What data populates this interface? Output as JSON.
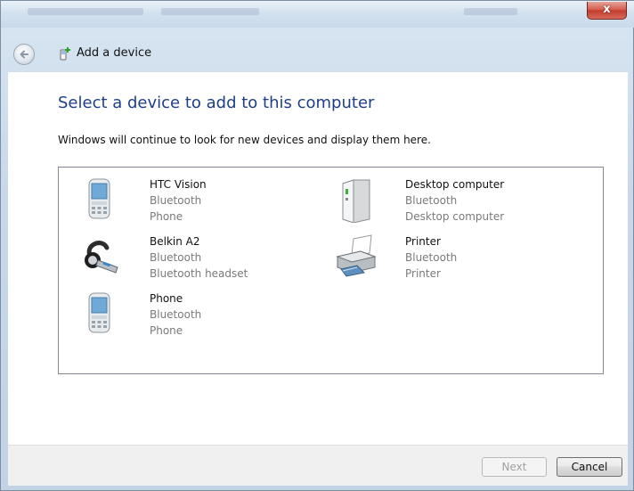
{
  "window": {
    "close_glyph": "x"
  },
  "nav": {
    "title": "Add a device"
  },
  "main": {
    "heading": "Select a device to add to this computer",
    "subtext": "Windows will continue to look for new devices and display them here."
  },
  "devices": [
    {
      "name": "HTC Vision",
      "connection": "Bluetooth",
      "category": "Phone",
      "icon": "mobile-phone-icon"
    },
    {
      "name": "Desktop computer",
      "connection": "Bluetooth",
      "category": "Desktop computer",
      "icon": "desktop-tower-icon"
    },
    {
      "name": "Belkin A2",
      "connection": "Bluetooth",
      "category": "Bluetooth headset",
      "icon": "bluetooth-headset-icon"
    },
    {
      "name": "Printer",
      "connection": "Bluetooth",
      "category": "Printer",
      "icon": "printer-icon"
    },
    {
      "name": "Phone",
      "connection": "Bluetooth",
      "category": "Phone",
      "icon": "mobile-phone-icon"
    }
  ],
  "footer": {
    "next_label": "Next",
    "cancel_label": "Cancel"
  }
}
